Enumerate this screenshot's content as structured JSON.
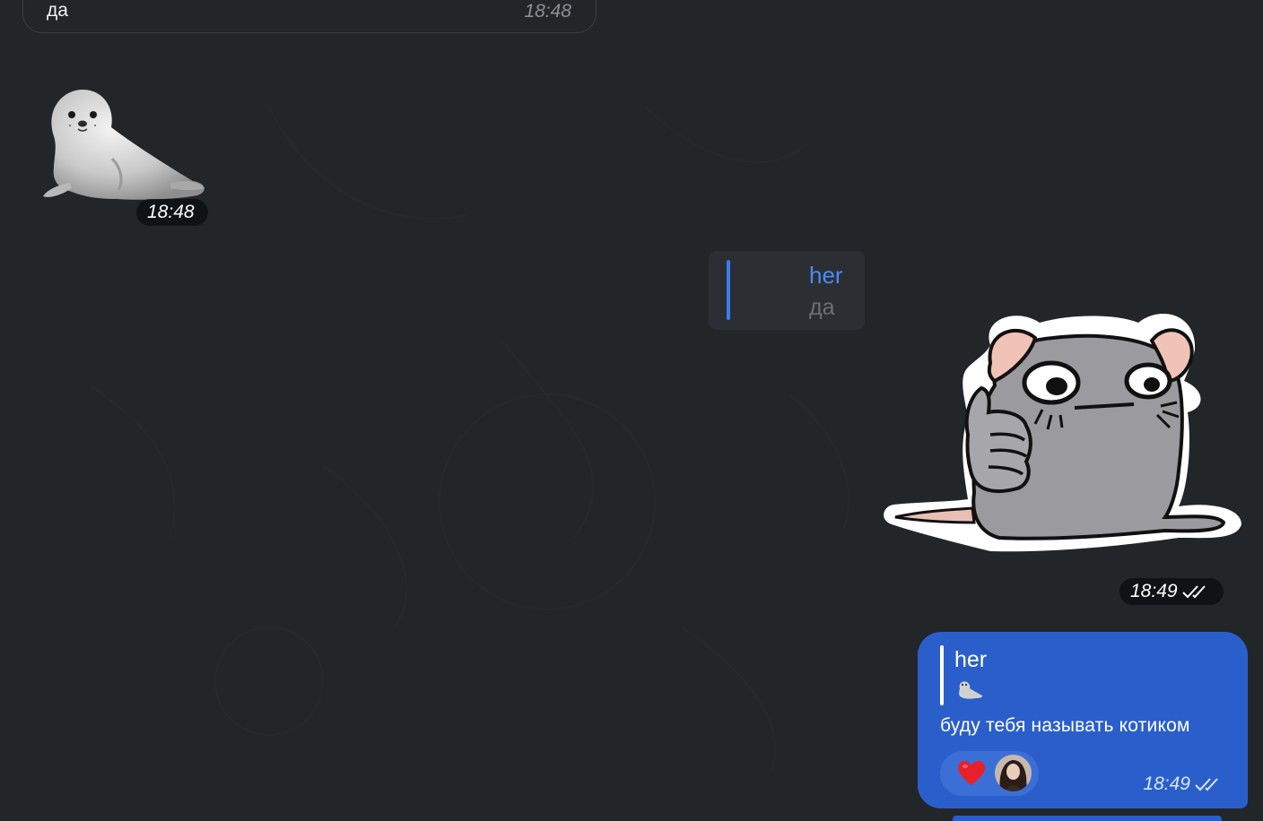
{
  "messages": {
    "incoming_text": {
      "text": "да",
      "time": "18:48"
    },
    "seal_sticker": {
      "icon": "seal-sticker",
      "time": "18:48"
    },
    "reply_preview": {
      "name": "her",
      "text": "да"
    },
    "rat_sticker": {
      "icon": "rat-thumbs-up-sticker",
      "time": "18:49"
    },
    "outgoing": {
      "quote_name": "her",
      "quote_text": "🦭",
      "text": "буду тебя называть котиком",
      "time": "18:49",
      "reaction": {
        "emoji": "heart-icon"
      }
    }
  },
  "colors": {
    "background": "#222629",
    "outgoing_bubble": "#2a5fcb",
    "accent_blue": "#4b8bf5"
  }
}
